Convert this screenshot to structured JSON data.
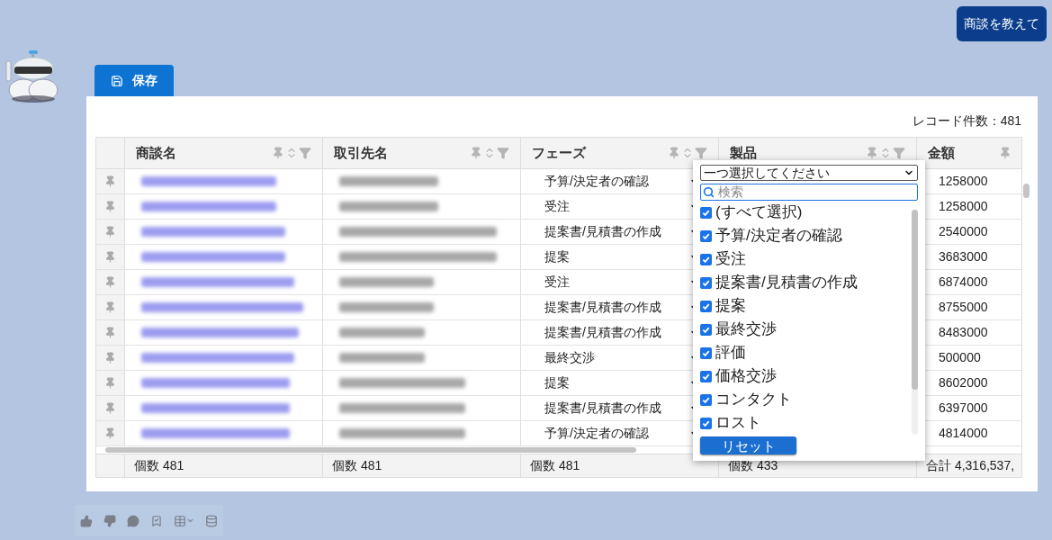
{
  "top_button": "商談を教えて",
  "save_button": "保存",
  "record_count": "レコード件数：481",
  "columns": [
    {
      "label": "商談名",
      "kind": "full"
    },
    {
      "label": "取引先名",
      "kind": "full"
    },
    {
      "label": "フェーズ",
      "kind": "full"
    },
    {
      "label": "製品",
      "kind": "full"
    },
    {
      "label": "金額",
      "kind": "partial"
    }
  ],
  "rows": [
    {
      "phase": "予算/決定者の確認",
      "amount": "1258000"
    },
    {
      "phase": "受注",
      "amount": "1258000"
    },
    {
      "phase": "提案書/見積書の作成",
      "amount": "2540000"
    },
    {
      "phase": "提案",
      "amount": "3683000"
    },
    {
      "phase": "受注",
      "amount": "6874000"
    },
    {
      "phase": "提案書/見積書の作成",
      "amount": "8755000"
    },
    {
      "phase": "提案書/見積書の作成",
      "amount": "8483000"
    },
    {
      "phase": "最終交渉",
      "amount": "500000"
    },
    {
      "phase": "提案",
      "amount": "8602000"
    },
    {
      "phase": "提案書/見積書の作成",
      "amount": "6397000"
    },
    {
      "phase": "予算/決定者の確認",
      "amount": "4814000"
    }
  ],
  "footer": [
    "個数 481",
    "個数 481",
    "個数 481",
    "個数 433",
    "合計 4,316,537,"
  ],
  "filter_popup": {
    "select_placeholder": "一つ選択してください",
    "search_placeholder": "検索",
    "options": [
      {
        "label": "(すべて選択)",
        "checked": true
      },
      {
        "label": "予算/決定者の確認",
        "checked": true
      },
      {
        "label": "受注",
        "checked": true
      },
      {
        "label": "提案書/見積書の作成",
        "checked": true
      },
      {
        "label": "提案",
        "checked": true
      },
      {
        "label": "最終交渉",
        "checked": true
      },
      {
        "label": "評価",
        "checked": true
      },
      {
        "label": "価格交渉",
        "checked": true
      },
      {
        "label": "コンタクト",
        "checked": true
      },
      {
        "label": "ロスト",
        "checked": true
      }
    ],
    "reset_button": "リセット"
  }
}
